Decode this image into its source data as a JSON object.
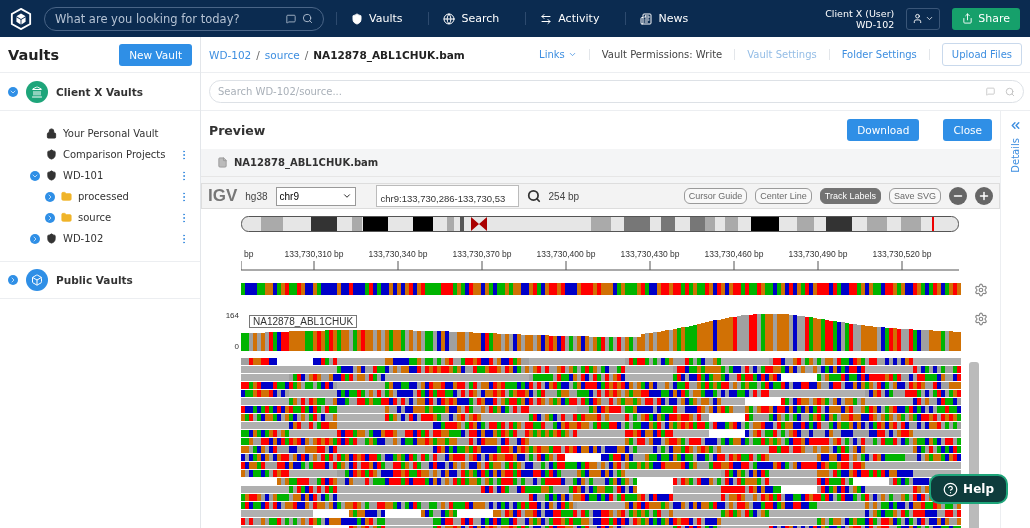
{
  "header": {
    "search_placeholder": "What are you looking for today?",
    "nav": [
      {
        "label": "Vaults"
      },
      {
        "label": "Search"
      },
      {
        "label": "Activity"
      },
      {
        "label": "News"
      }
    ],
    "user": {
      "name": "Client X (User)",
      "vault": "WD-102"
    },
    "share": "Share"
  },
  "sidebar": {
    "title": "Vaults",
    "new_vault": "New Vault",
    "groups": [
      {
        "label": "Client X Vaults",
        "kind": "client",
        "expanded": true,
        "children": [
          {
            "label": "Your Personal Vault",
            "kind": "personal"
          },
          {
            "label": "Comparison Projects",
            "kind": "project"
          },
          {
            "label": "WD-101",
            "kind": "vault",
            "expanded": true,
            "children": [
              {
                "label": "processed",
                "kind": "folder",
                "expanded": false
              },
              {
                "label": "source",
                "kind": "folder",
                "expanded": false
              }
            ]
          },
          {
            "label": "WD-102",
            "kind": "vault",
            "expanded": false
          }
        ]
      },
      {
        "label": "Public Vaults",
        "kind": "public",
        "expanded": false
      }
    ]
  },
  "breadcrumb": {
    "items": [
      "WD-102",
      "source",
      "NA12878_ABL1CHUK.bam"
    ],
    "separators": [
      "/",
      "/"
    ]
  },
  "toolbar": {
    "links": "Links",
    "permissions": "Vault Permissions: Write",
    "vault_settings": {
      "label": "Vault Settings",
      "disabled": true
    },
    "folder_settings": {
      "label": "Folder Settings",
      "disabled": false
    },
    "upload": "Upload Files"
  },
  "file_search": {
    "placeholder": "Search WD-102/source..."
  },
  "preview": {
    "title": "Preview",
    "buttons": [
      "Download",
      "Close"
    ],
    "file_name": "NA12878_ABL1CHUK.bam"
  },
  "igv": {
    "logo": "IGV",
    "genome": "hg38",
    "chromosome": "chr9",
    "locus": "chr9:133,730,286-133,730,53",
    "width": "254 bp",
    "toggles": [
      {
        "label": "Cursor Guide",
        "on": false
      },
      {
        "label": "Center Line",
        "on": false
      },
      {
        "label": "Track Labels",
        "on": true
      }
    ],
    "save": "Save SVG",
    "ruler": [
      "bp",
      "133,730,310 bp",
      "133,730,340 bp",
      "133,730,370 bp",
      "133,730,400 bp",
      "133,730,430 bp",
      "133,730,460 bp",
      "133,730,490 bp",
      "133,730,520 bp"
    ],
    "track_label": "NA12878_ABL1CHUK",
    "scale_max": "164",
    "scale_min": "0"
  },
  "details": "Details",
  "help": "Help"
}
